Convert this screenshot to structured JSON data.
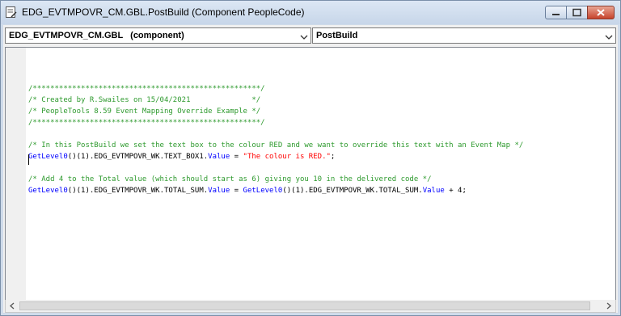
{
  "window": {
    "title": "EDG_EVTMPOVR_CM.GBL.PostBuild (Component PeopleCode)"
  },
  "toolbar": {
    "object_select": "EDG_EVTMPOVR_CM.GBL   (component)",
    "event_select": "PostBuild"
  },
  "editor": {
    "lines": [
      [
        {
          "t": "/****************************************************/",
          "c": "comment"
        }
      ],
      [
        {
          "t": "/* Created by R.Swailes on 15/04/2021              */",
          "c": "comment"
        }
      ],
      [
        {
          "t": "/* PeopleTools 8.59 Event Mapping Override Example */",
          "c": "comment"
        }
      ],
      [
        {
          "t": "/****************************************************/",
          "c": "comment"
        }
      ],
      [],
      [
        {
          "t": "/* In this PostBuild we set the text box to the colour RED and we want to override this text with an Event Map */",
          "c": "comment"
        }
      ],
      [
        {
          "t": "GetLevel0",
          "c": "builtin"
        },
        {
          "t": "()(1).EDG_EVTMPOVR_WK.TEXT_BOX1.",
          "c": "plain"
        },
        {
          "t": "Value",
          "c": "builtin"
        },
        {
          "t": " = ",
          "c": "plain"
        },
        {
          "t": "\"The colour is RED.\"",
          "c": "string"
        },
        {
          "t": ";",
          "c": "plain"
        }
      ],
      [],
      [
        {
          "t": "/* Add 4 to the Total value (which should start as 6) giving you 10 in the delivered code */",
          "c": "comment"
        }
      ],
      [
        {
          "t": "GetLevel0",
          "c": "builtin"
        },
        {
          "t": "()(1).EDG_EVTMPOVR_WK.TOTAL_SUM.",
          "c": "plain"
        },
        {
          "t": "Value",
          "c": "builtin"
        },
        {
          "t": " = ",
          "c": "plain"
        },
        {
          "t": "GetLevel0",
          "c": "builtin"
        },
        {
          "t": "()(1).EDG_EVTMPOVR_WK.TOTAL_SUM.",
          "c": "plain"
        },
        {
          "t": "Value",
          "c": "builtin"
        },
        {
          "t": " + 4;",
          "c": "plain"
        }
      ]
    ]
  },
  "icons": {
    "title": "code-window-icon",
    "minimize": "minimize-icon",
    "maximize": "maximize-icon",
    "close": "close-icon",
    "dropdown": "chevron-down-icon",
    "scroll_left": "scroll-left-icon",
    "scroll_right": "scroll-right-icon"
  },
  "colors": {
    "comment": "#2e9a2e",
    "builtin": "#0000ff",
    "plain": "#000000",
    "string": "#ff0000",
    "close_button": "#c7432c"
  }
}
